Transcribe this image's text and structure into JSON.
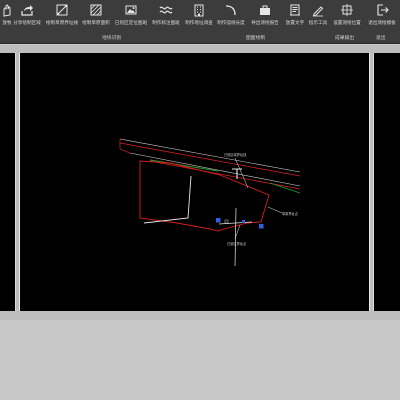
{
  "toolbar": {
    "tools": [
      {
        "label": "放牧",
        "icon": "hand-icon"
      },
      {
        "label": "分享绘制区域",
        "icon": "share-icon"
      },
      {
        "label": "绘制草原界址线",
        "icon": "draw-boundary-icon"
      },
      {
        "label": "绘制草原面积",
        "icon": "hatch-area-icon"
      },
      {
        "label": "已划区定位图斑",
        "icon": "image-icon"
      },
      {
        "label": "制作标注图斑",
        "icon": "wave-icon"
      },
      {
        "label": "制作地址调查",
        "icon": "building-icon"
      },
      {
        "label": "制作弧线长度",
        "icon": "arc-icon"
      },
      {
        "label": "导出测绘报告",
        "icon": "briefcase-icon"
      },
      {
        "label": "放置文字",
        "icon": "document-icon"
      },
      {
        "label": "指示工具",
        "icon": "pen-icon"
      },
      {
        "label": "设置测绘位置",
        "icon": "target-icon"
      },
      {
        "label": "退出测绘模板",
        "icon": "exit-icon"
      }
    ],
    "groups": [
      {
        "label": "地块识别"
      },
      {
        "label": "图面绘制"
      },
      {
        "label": "成果输出"
      },
      {
        "label": "退出"
      }
    ]
  },
  "canvas": {
    "annotations": [
      {
        "text": "已划区域界址线"
      },
      {
        "text": "草原界址点"
      },
      {
        "text": "已划区界址点"
      }
    ]
  }
}
